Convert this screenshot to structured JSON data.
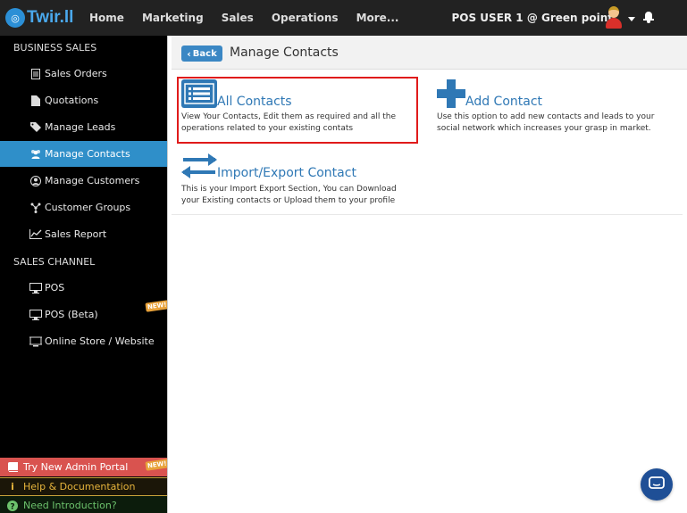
{
  "topbar": {
    "logo_text": "Twir.ll",
    "nav": [
      "Home",
      "Marketing",
      "Sales",
      "Operations",
      "More..."
    ],
    "user_label": "POS USER 1 @ Green point"
  },
  "sidebar": {
    "section_business": "BUSINESS SALES",
    "business_items": [
      {
        "label": "Sales Orders",
        "icon": "document-icon"
      },
      {
        "label": "Quotations",
        "icon": "file-icon"
      },
      {
        "label": "Manage Leads",
        "icon": "tags-icon"
      },
      {
        "label": "Manage Contacts",
        "icon": "users-icon"
      },
      {
        "label": "Manage Customers",
        "icon": "user-circle-icon"
      },
      {
        "label": "Customer Groups",
        "icon": "group-icon"
      },
      {
        "label": "Sales Report",
        "icon": "line-chart-icon"
      }
    ],
    "section_channel": "SALES CHANNEL",
    "channel_items": [
      {
        "label": "POS",
        "icon": "monitor-icon"
      },
      {
        "label": "POS (Beta)",
        "icon": "monitor-icon",
        "badge": "NEW!"
      },
      {
        "label": "Online Store / Website",
        "icon": "store-icon"
      }
    ],
    "bottom": {
      "portal": "Try New Admin Portal",
      "portal_badge": "NEW!",
      "help": "Help & Documentation",
      "intro": "Need Introduction?"
    }
  },
  "main": {
    "back_label": "Back",
    "title": "Manage Contacts",
    "cards": [
      {
        "title": "All Contacts",
        "desc": "View Your Contacts, Edit them as required and all the operations related to your existing contats",
        "icon": "list-icon"
      },
      {
        "title": "Add Contact",
        "desc": "Use this option to add new contacts and leads to your social network which increases your grasp in market.",
        "icon": "plus-icon"
      },
      {
        "title": "Import/Export Contact",
        "desc": "This is your Import Export Section, You can Download your Existing contacts or Upload them to your profile",
        "icon": "exchange-icon"
      }
    ]
  },
  "colors": {
    "topbar_bg": "#222222",
    "sidebar_bg": "#000000",
    "active_item": "#2f8fc9",
    "accent_blue": "#2f78b5",
    "highlight_border": "#e01b1b"
  }
}
